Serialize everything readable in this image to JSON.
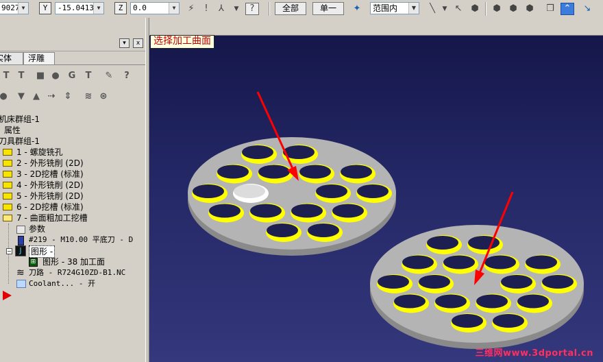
{
  "toolbar": {
    "x_value": "9027",
    "y_label": "Y",
    "y_value": "-15.04133",
    "z_label": "Z",
    "z_value": "0.0",
    "btn_all": "全部",
    "btn_single": "单一",
    "select_mode": "范围内"
  },
  "panel": {
    "tab_solid": "实体",
    "tab_relief": "浮雕",
    "collapse_btn": "▾",
    "close_btn": "x"
  },
  "tree": {
    "machine_group": "机床群组-1",
    "properties": "属性",
    "toolpath_group": "刀具群组-1",
    "ops": [
      "1 - 螺旋铣孔",
      "2 - 外形铣削 (2D)",
      "3 - 2D挖槽 (标准)",
      "4 - 外形铣削 (2D)",
      "5 - 外形铣削 (2D)",
      "6 - 2D挖槽 (标准)",
      "7 - 曲面粗加工挖槽"
    ],
    "params": "参数",
    "tool": "#219 - M10.00 平底刀 - D",
    "geometry": "图形 -",
    "geometry_sub": "图形 - 38 加工面",
    "toolpath": "刀路 - R724G10ZD-B1.NC",
    "coolant": "Coolant... - 开"
  },
  "viewport": {
    "prompt": "选择加工曲面",
    "watermark": "三维网www.3dportal.cn"
  },
  "colors": {
    "viewport_top": "#15174a",
    "viewport_bottom": "#34387c",
    "part_top": "#b4b4b4",
    "part_side": "#8a8a8a",
    "hole_wall": "#ffff00",
    "hole_dark": "#1d1f50",
    "selected_hole": "#ffffff",
    "arrow": "#ff0000",
    "prompt_text": "#c00000"
  }
}
